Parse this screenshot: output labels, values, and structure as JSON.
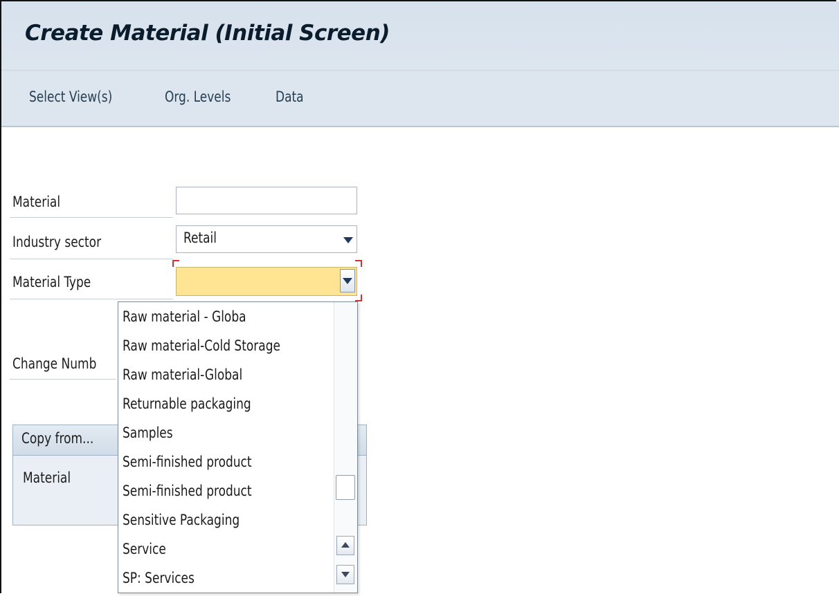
{
  "window": {
    "title": "Create Material (Initial Screen)"
  },
  "toolbar": {
    "items": [
      "Select View(s)",
      "Org. Levels",
      "Data"
    ]
  },
  "form": {
    "material_label": "Material",
    "material_value": "",
    "industry_sector_label": "Industry sector",
    "industry_sector_value": "Retail",
    "material_type_label": "Material Type",
    "material_type_value": "",
    "change_number_label": "Change Numb"
  },
  "copy_from": {
    "header": "Copy from...",
    "material_label": "Material"
  },
  "dropdown": {
    "options": [
      "Raw material - Globa",
      "Raw material-Cold Storage",
      "Raw material-Global",
      "Returnable packaging",
      "Samples",
      "Semi-finished product",
      "Semi-finished product",
      "Sensitive Packaging",
      "Service",
      "SP: Services"
    ]
  },
  "colors": {
    "title_bar": "#d7e1ec",
    "toolbar": "#dde6ef",
    "required_field": "#ffe494",
    "error_corner": "#e22a2a"
  }
}
